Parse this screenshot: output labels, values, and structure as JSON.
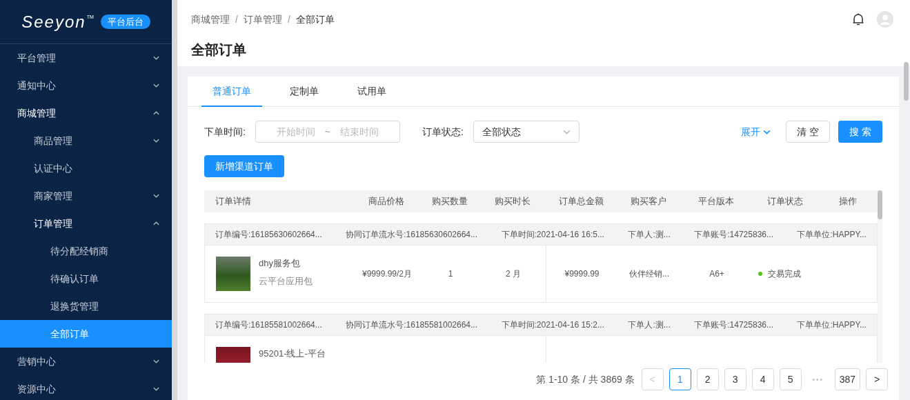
{
  "sidebar": {
    "logo": "Seeyon",
    "logo_mark": "TM",
    "badge": "平台后台",
    "items": [
      {
        "label": "平台管理",
        "expanded": false,
        "selected": false
      },
      {
        "label": "通知中心",
        "expanded": false,
        "selected": false
      },
      {
        "label": "商城管理",
        "expanded": true,
        "selected": false,
        "children": [
          {
            "label": "商品管理",
            "expanded": false,
            "selected": false
          },
          {
            "label": "认证中心",
            "selected": false
          },
          {
            "label": "商家管理",
            "expanded": false,
            "selected": false
          },
          {
            "label": "订单管理",
            "expanded": true,
            "selected": false,
            "children": [
              {
                "label": "待分配经销商",
                "selected": false
              },
              {
                "label": "待确认订单",
                "selected": false
              },
              {
                "label": "退换货管理",
                "selected": false
              },
              {
                "label": "全部订单",
                "selected": true
              }
            ]
          }
        ]
      },
      {
        "label": "营销中心",
        "expanded": false,
        "selected": false
      },
      {
        "label": "资源中心",
        "expanded": false,
        "selected": false
      }
    ]
  },
  "header": {
    "breadcrumb": [
      "商城管理",
      "订单管理",
      "全部订单"
    ],
    "separator": "/",
    "title": "全部订单"
  },
  "tabs": [
    {
      "label": "普通订单",
      "selected": true
    },
    {
      "label": "定制单",
      "selected": false
    },
    {
      "label": "试用单",
      "selected": false
    }
  ],
  "filters": {
    "time_label": "下单时间:",
    "start_placeholder": "开始时间",
    "range_sep": "~",
    "end_placeholder": "结束时间",
    "status_label": "订单状态:",
    "status_value": "全部状态",
    "expand": "展开",
    "clear": "清 空",
    "search": "搜 索",
    "add": "新增渠道订单"
  },
  "table": {
    "columns": [
      "订单详情",
      "商品价格",
      "购买数量",
      "购买时长",
      "订单总金额",
      "购买客户",
      "平台版本",
      "订单状态",
      "操作"
    ],
    "orders": [
      {
        "meta": [
          "订单编号:16185630602664...",
          "协同订单流水号:16185630602664...",
          "下单时间:2021-04-16 16:5...",
          "下单人:测...",
          "下单账号:14725836...",
          "下单单位:HAPPY..."
        ],
        "name": "dhy服务包",
        "subtitle": "云平台应用包",
        "price": "¥9999.99/2月",
        "quantity": "1",
        "duration": "2 月",
        "total": "¥9999.99",
        "customer": "伙伴经销...",
        "version": "A6+",
        "status": "交易完成",
        "color": "#52c41a"
      },
      {
        "meta": [
          "订单编号:16185581002664...",
          "协同订单流水号:16185581002664...",
          "下单时间:2021-04-16 15:2...",
          "下单人:测...",
          "下单账号:14725836...",
          "下单单位:HAPPY..."
        ],
        "name": "95201-线上-平台"
      }
    ]
  },
  "pagination": {
    "summary": "第 1-10 条 / 共 3869 条",
    "items": [
      {
        "kind": "prev",
        "label": "<",
        "disabled": true
      },
      {
        "kind": "page",
        "label": "1",
        "selected": true
      },
      {
        "kind": "page",
        "label": "2",
        "selected": false
      },
      {
        "kind": "page",
        "label": "3",
        "selected": false
      },
      {
        "kind": "page",
        "label": "4",
        "selected": false
      },
      {
        "kind": "page",
        "label": "5",
        "selected": false
      },
      {
        "kind": "ellipsis",
        "label": "•••"
      },
      {
        "kind": "page",
        "label": "387",
        "selected": false
      },
      {
        "kind": "next",
        "label": ">",
        "disabled": false
      }
    ]
  }
}
